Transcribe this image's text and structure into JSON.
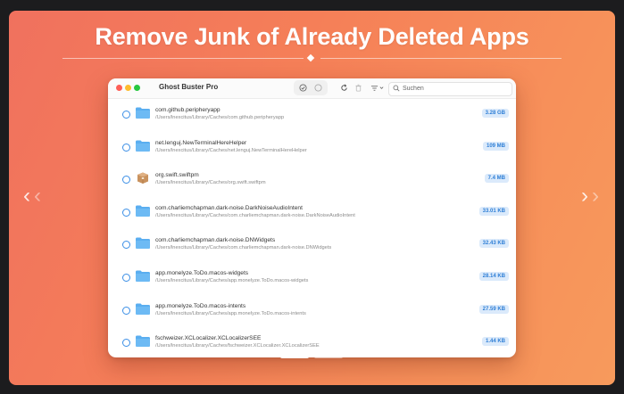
{
  "banner": {
    "headline": "Remove Junk of Already Deleted Apps"
  },
  "window": {
    "app_title": "Ghost Buster Pro",
    "search_placeholder": "Suchen"
  },
  "items": [
    {
      "name": "com.github.peripheryapp",
      "path": "/Users/lnexcitus/Library/Caches/com.github.peripheryapp",
      "size": "3.28 GB",
      "icon": "folder-icon"
    },
    {
      "name": "net.lenguj.NewTerminalHereHelper",
      "path": "/Users/lnexcitus/Library/Caches/net.lenguj.NewTerminalHereHelper",
      "size": "109 MB",
      "icon": "folder-icon"
    },
    {
      "name": "org.swift.swiftpm",
      "path": "/Users/lnexcitus/Library/Caches/org.swift.swiftpm",
      "size": "7.4 MB",
      "icon": "package-icon"
    },
    {
      "name": "com.charliemchapman.dark-noise.DarkNoiseAudioIntent",
      "path": "/Users/lnexcitus/Library/Caches/com.charliemchapman.dark-noise.DarkNoiseAudioIntent",
      "size": "33.01 KB",
      "icon": "folder-icon"
    },
    {
      "name": "com.charliemchapman.dark-noise.DNWidgets",
      "path": "/Users/lnexcitus/Library/Caches/com.charliemchapman.dark-noise.DNWidgets",
      "size": "32.43 KB",
      "icon": "folder-icon"
    },
    {
      "name": "app.monelyze.ToDo.macos-widgets",
      "path": "/Users/lnexcitus/Library/Caches/app.monelyze.ToDo.macos-widgets",
      "size": "28.14 KB",
      "icon": "folder-icon"
    },
    {
      "name": "app.monelyze.ToDo.macos-intents",
      "path": "/Users/lnexcitus/Library/Caches/app.monelyze.ToDo.macos-intents",
      "size": "27.59 KB",
      "icon": "folder-icon"
    },
    {
      "name": "fschweizer.XCLocalizer.XCLocalizerSEE",
      "path": "/Users/lnexcitus/Library/Caches/fschweizer.XCLocalizer.XCLocalizerSEE",
      "size": "1.44 KB",
      "icon": "folder-icon"
    }
  ],
  "colors": {
    "accent": "#3a8ee6",
    "badge_bg": "#dbeafb",
    "badge_text": "#2f7fd6",
    "folder": "#5aaef0"
  }
}
